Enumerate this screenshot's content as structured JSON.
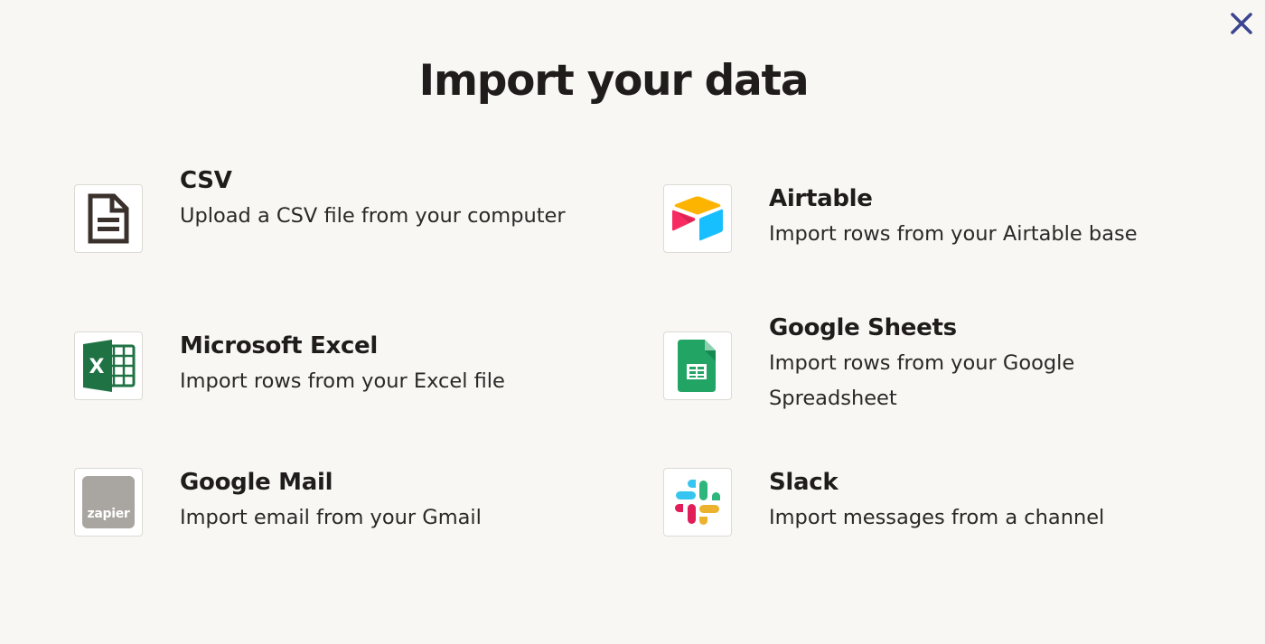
{
  "title": "Import your data",
  "close_icon": "close-icon",
  "options": [
    {
      "name": "CSV",
      "description": "Upload a CSV file from your computer",
      "icon": "document-icon"
    },
    {
      "name": "Airtable",
      "description": "Import rows from your Airtable base",
      "icon": "airtable-icon"
    },
    {
      "name": "Microsoft Excel",
      "description": "Import rows from your Excel file",
      "icon": "excel-icon"
    },
    {
      "name": "Google Sheets",
      "description": "Import rows from your Google Spreadsheet",
      "icon": "google-sheets-icon"
    },
    {
      "name": "Google Mail",
      "description": "Import email from your Gmail",
      "icon": "zapier-icon",
      "icon_text": "zapier"
    },
    {
      "name": "Slack",
      "description": "Import messages from a channel",
      "icon": "slack-icon"
    }
  ],
  "colors": {
    "background": "#f8f7f3",
    "close": "#3d4592",
    "text": "#201c1c",
    "excel_green": "#1f7244",
    "sheets_green": "#21a464",
    "zapier_gray": "#a9a5a0"
  }
}
